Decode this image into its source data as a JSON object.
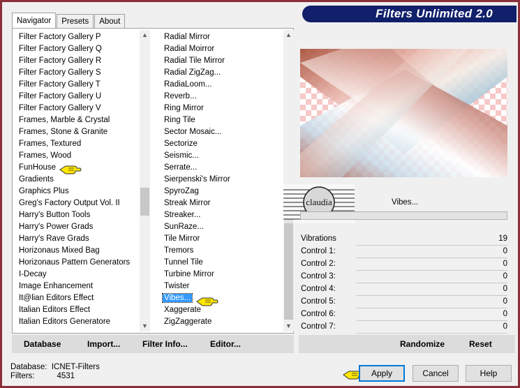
{
  "app": {
    "title": "Filters Unlimited 2.0"
  },
  "tabs": [
    {
      "label": "Navigator"
    },
    {
      "label": "Presets"
    },
    {
      "label": "About"
    }
  ],
  "categories": [
    "Filter Factory Gallery P",
    "Filter Factory Gallery Q",
    "Filter Factory Gallery R",
    "Filter Factory Gallery S",
    "Filter Factory Gallery T",
    "Filter Factory Gallery U",
    "Filter Factory Gallery V",
    "Frames, Marble & Crystal",
    "Frames, Stone & Granite",
    "Frames, Textured",
    "Frames, Wood",
    "FunHouse",
    "Gradients",
    "Graphics Plus",
    "Greg's Factory Output Vol. II",
    "Harry's Button Tools",
    "Harry's Power Grads",
    "Harry's Rave Grads",
    "Horizonaus Mixed Bag",
    "Horizonaus Pattern Generators",
    "I-Decay",
    "Image Enhancement",
    "It@lian Editors Effect",
    "Italian Editors Effect",
    "Italian Editors Generatore"
  ],
  "filters": [
    "Radial Mirror",
    "Radial Moirror",
    "Radial Tile Mirror",
    "Radial ZigZag...",
    "RadiaLoom...",
    "Reverb...",
    "Ring Mirror",
    "Ring Tile",
    "Sector Mosaic...",
    "Sectorize",
    "Seismic...",
    "Serrate...",
    "Sierpenski's Mirror",
    "SpyroZag",
    "Streak Mirror",
    "Streaker...",
    "SunRaze...",
    "Tile Mirror",
    "Tremors",
    "Tunnel Tile",
    "Turbine Mirror",
    "Twister",
    "Vibes...",
    "Xaggerate",
    "ZigZaggerate"
  ],
  "selected_filter": "Vibes...",
  "bottom_buttons": {
    "database": "Database",
    "import": "Import...",
    "filter_info": "Filter Info...",
    "editor": "Editor..."
  },
  "filter_name": "Vibes...",
  "watermark_text": "claudia",
  "params": [
    {
      "label": "Vibrations",
      "value": "19"
    },
    {
      "label": "Control 1:",
      "value": "0"
    },
    {
      "label": "Control 2:",
      "value": "0"
    },
    {
      "label": "Control 3:",
      "value": "0"
    },
    {
      "label": "Control 4:",
      "value": "0"
    },
    {
      "label": "Control 5:",
      "value": "0"
    },
    {
      "label": "Control 6:",
      "value": "0"
    },
    {
      "label": "Control 7:",
      "value": "0"
    }
  ],
  "randomize": "Randomize",
  "reset": "Reset",
  "status": {
    "db_label": "Database:",
    "db_value": "ICNET-Filters",
    "filters_label": "Filters:",
    "filters_value": "4531"
  },
  "dialog": {
    "apply": "Apply",
    "cancel": "Cancel",
    "help": "Help"
  },
  "colors": {
    "frame": "#8b2f3a",
    "banner": "#10206a",
    "selection": "#3399ff"
  }
}
